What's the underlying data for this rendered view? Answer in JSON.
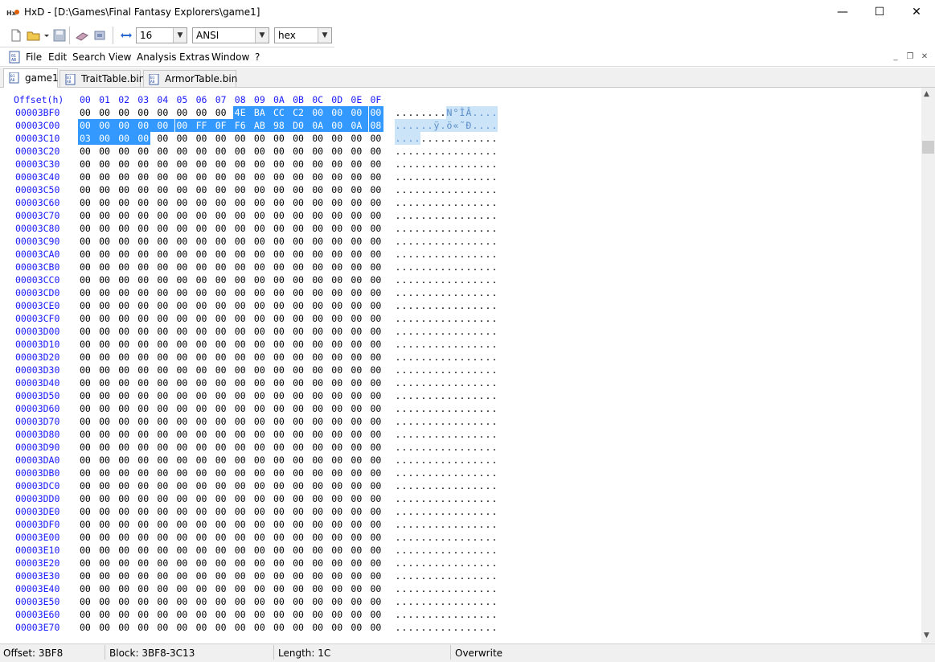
{
  "window": {
    "title": "HxD - [D:\\Games\\Final Fantasy Explorers\\game1]",
    "minimize_glyph": "—",
    "maximize_glyph": "☐",
    "close_glyph": "✕"
  },
  "toolbar": {
    "bytes_per_row": "16",
    "charset": "ANSI",
    "offset_base": "hex"
  },
  "menu": {
    "items": [
      "File",
      "Edit",
      "Search",
      "View",
      "Analysis",
      "Extras",
      "Window",
      "?"
    ]
  },
  "tabs": [
    {
      "label": "game1",
      "active": true
    },
    {
      "label": "TraitTable.bin",
      "active": false
    },
    {
      "label": "ArmorTable.bin",
      "active": false
    }
  ],
  "hex": {
    "header_label": "Offset(h)",
    "columns": [
      "00",
      "01",
      "02",
      "03",
      "04",
      "05",
      "06",
      "07",
      "08",
      "09",
      "0A",
      "0B",
      "0C",
      "0D",
      "0E",
      "0F"
    ],
    "rows": [
      {
        "offset": "00003BF0",
        "bytes": [
          "00",
          "00",
          "00",
          "00",
          "00",
          "00",
          "00",
          "00",
          "4E",
          "BA",
          "CC",
          "C2",
          "00",
          "00",
          "00",
          "00"
        ],
        "text": "........N°ÌÂ...."
      },
      {
        "offset": "00003C00",
        "bytes": [
          "00",
          "00",
          "00",
          "00",
          "00",
          "00",
          "FF",
          "0F",
          "F6",
          "AB",
          "98",
          "D0",
          "0A",
          "00",
          "0A",
          "08"
        ],
        "text": "......ÿ.ö«˜Ð...."
      },
      {
        "offset": "00003C10",
        "bytes": [
          "03",
          "00",
          "00",
          "00",
          "00",
          "00",
          "00",
          "00",
          "00",
          "00",
          "00",
          "00",
          "00",
          "00",
          "00",
          "00"
        ],
        "text": "................"
      },
      {
        "offset": "00003C20",
        "bytes": [
          "00",
          "00",
          "00",
          "00",
          "00",
          "00",
          "00",
          "00",
          "00",
          "00",
          "00",
          "00",
          "00",
          "00",
          "00",
          "00"
        ],
        "text": "................"
      },
      {
        "offset": "00003C30",
        "bytes": [
          "00",
          "00",
          "00",
          "00",
          "00",
          "00",
          "00",
          "00",
          "00",
          "00",
          "00",
          "00",
          "00",
          "00",
          "00",
          "00"
        ],
        "text": "................"
      },
      {
        "offset": "00003C40",
        "bytes": [
          "00",
          "00",
          "00",
          "00",
          "00",
          "00",
          "00",
          "00",
          "00",
          "00",
          "00",
          "00",
          "00",
          "00",
          "00",
          "00"
        ],
        "text": "................"
      },
      {
        "offset": "00003C50",
        "bytes": [
          "00",
          "00",
          "00",
          "00",
          "00",
          "00",
          "00",
          "00",
          "00",
          "00",
          "00",
          "00",
          "00",
          "00",
          "00",
          "00"
        ],
        "text": "................"
      },
      {
        "offset": "00003C60",
        "bytes": [
          "00",
          "00",
          "00",
          "00",
          "00",
          "00",
          "00",
          "00",
          "00",
          "00",
          "00",
          "00",
          "00",
          "00",
          "00",
          "00"
        ],
        "text": "................"
      },
      {
        "offset": "00003C70",
        "bytes": [
          "00",
          "00",
          "00",
          "00",
          "00",
          "00",
          "00",
          "00",
          "00",
          "00",
          "00",
          "00",
          "00",
          "00",
          "00",
          "00"
        ],
        "text": "................"
      },
      {
        "offset": "00003C80",
        "bytes": [
          "00",
          "00",
          "00",
          "00",
          "00",
          "00",
          "00",
          "00",
          "00",
          "00",
          "00",
          "00",
          "00",
          "00",
          "00",
          "00"
        ],
        "text": "................"
      },
      {
        "offset": "00003C90",
        "bytes": [
          "00",
          "00",
          "00",
          "00",
          "00",
          "00",
          "00",
          "00",
          "00",
          "00",
          "00",
          "00",
          "00",
          "00",
          "00",
          "00"
        ],
        "text": "................"
      },
      {
        "offset": "00003CA0",
        "bytes": [
          "00",
          "00",
          "00",
          "00",
          "00",
          "00",
          "00",
          "00",
          "00",
          "00",
          "00",
          "00",
          "00",
          "00",
          "00",
          "00"
        ],
        "text": "................"
      },
      {
        "offset": "00003CB0",
        "bytes": [
          "00",
          "00",
          "00",
          "00",
          "00",
          "00",
          "00",
          "00",
          "00",
          "00",
          "00",
          "00",
          "00",
          "00",
          "00",
          "00"
        ],
        "text": "................"
      },
      {
        "offset": "00003CC0",
        "bytes": [
          "00",
          "00",
          "00",
          "00",
          "00",
          "00",
          "00",
          "00",
          "00",
          "00",
          "00",
          "00",
          "00",
          "00",
          "00",
          "00"
        ],
        "text": "................"
      },
      {
        "offset": "00003CD0",
        "bytes": [
          "00",
          "00",
          "00",
          "00",
          "00",
          "00",
          "00",
          "00",
          "00",
          "00",
          "00",
          "00",
          "00",
          "00",
          "00",
          "00"
        ],
        "text": "................"
      },
      {
        "offset": "00003CE0",
        "bytes": [
          "00",
          "00",
          "00",
          "00",
          "00",
          "00",
          "00",
          "00",
          "00",
          "00",
          "00",
          "00",
          "00",
          "00",
          "00",
          "00"
        ],
        "text": "................"
      },
      {
        "offset": "00003CF0",
        "bytes": [
          "00",
          "00",
          "00",
          "00",
          "00",
          "00",
          "00",
          "00",
          "00",
          "00",
          "00",
          "00",
          "00",
          "00",
          "00",
          "00"
        ],
        "text": "................"
      },
      {
        "offset": "00003D00",
        "bytes": [
          "00",
          "00",
          "00",
          "00",
          "00",
          "00",
          "00",
          "00",
          "00",
          "00",
          "00",
          "00",
          "00",
          "00",
          "00",
          "00"
        ],
        "text": "................"
      },
      {
        "offset": "00003D10",
        "bytes": [
          "00",
          "00",
          "00",
          "00",
          "00",
          "00",
          "00",
          "00",
          "00",
          "00",
          "00",
          "00",
          "00",
          "00",
          "00",
          "00"
        ],
        "text": "................"
      },
      {
        "offset": "00003D20",
        "bytes": [
          "00",
          "00",
          "00",
          "00",
          "00",
          "00",
          "00",
          "00",
          "00",
          "00",
          "00",
          "00",
          "00",
          "00",
          "00",
          "00"
        ],
        "text": "................"
      },
      {
        "offset": "00003D30",
        "bytes": [
          "00",
          "00",
          "00",
          "00",
          "00",
          "00",
          "00",
          "00",
          "00",
          "00",
          "00",
          "00",
          "00",
          "00",
          "00",
          "00"
        ],
        "text": "................"
      },
      {
        "offset": "00003D40",
        "bytes": [
          "00",
          "00",
          "00",
          "00",
          "00",
          "00",
          "00",
          "00",
          "00",
          "00",
          "00",
          "00",
          "00",
          "00",
          "00",
          "00"
        ],
        "text": "................"
      },
      {
        "offset": "00003D50",
        "bytes": [
          "00",
          "00",
          "00",
          "00",
          "00",
          "00",
          "00",
          "00",
          "00",
          "00",
          "00",
          "00",
          "00",
          "00",
          "00",
          "00"
        ],
        "text": "................"
      },
      {
        "offset": "00003D60",
        "bytes": [
          "00",
          "00",
          "00",
          "00",
          "00",
          "00",
          "00",
          "00",
          "00",
          "00",
          "00",
          "00",
          "00",
          "00",
          "00",
          "00"
        ],
        "text": "................"
      },
      {
        "offset": "00003D70",
        "bytes": [
          "00",
          "00",
          "00",
          "00",
          "00",
          "00",
          "00",
          "00",
          "00",
          "00",
          "00",
          "00",
          "00",
          "00",
          "00",
          "00"
        ],
        "text": "................"
      },
      {
        "offset": "00003D80",
        "bytes": [
          "00",
          "00",
          "00",
          "00",
          "00",
          "00",
          "00",
          "00",
          "00",
          "00",
          "00",
          "00",
          "00",
          "00",
          "00",
          "00"
        ],
        "text": "................"
      },
      {
        "offset": "00003D90",
        "bytes": [
          "00",
          "00",
          "00",
          "00",
          "00",
          "00",
          "00",
          "00",
          "00",
          "00",
          "00",
          "00",
          "00",
          "00",
          "00",
          "00"
        ],
        "text": "................"
      },
      {
        "offset": "00003DA0",
        "bytes": [
          "00",
          "00",
          "00",
          "00",
          "00",
          "00",
          "00",
          "00",
          "00",
          "00",
          "00",
          "00",
          "00",
          "00",
          "00",
          "00"
        ],
        "text": "................"
      },
      {
        "offset": "00003DB0",
        "bytes": [
          "00",
          "00",
          "00",
          "00",
          "00",
          "00",
          "00",
          "00",
          "00",
          "00",
          "00",
          "00",
          "00",
          "00",
          "00",
          "00"
        ],
        "text": "................"
      },
      {
        "offset": "00003DC0",
        "bytes": [
          "00",
          "00",
          "00",
          "00",
          "00",
          "00",
          "00",
          "00",
          "00",
          "00",
          "00",
          "00",
          "00",
          "00",
          "00",
          "00"
        ],
        "text": "................"
      },
      {
        "offset": "00003DD0",
        "bytes": [
          "00",
          "00",
          "00",
          "00",
          "00",
          "00",
          "00",
          "00",
          "00",
          "00",
          "00",
          "00",
          "00",
          "00",
          "00",
          "00"
        ],
        "text": "................"
      },
      {
        "offset": "00003DE0",
        "bytes": [
          "00",
          "00",
          "00",
          "00",
          "00",
          "00",
          "00",
          "00",
          "00",
          "00",
          "00",
          "00",
          "00",
          "00",
          "00",
          "00"
        ],
        "text": "................"
      },
      {
        "offset": "00003DF0",
        "bytes": [
          "00",
          "00",
          "00",
          "00",
          "00",
          "00",
          "00",
          "00",
          "00",
          "00",
          "00",
          "00",
          "00",
          "00",
          "00",
          "00"
        ],
        "text": "................"
      },
      {
        "offset": "00003E00",
        "bytes": [
          "00",
          "00",
          "00",
          "00",
          "00",
          "00",
          "00",
          "00",
          "00",
          "00",
          "00",
          "00",
          "00",
          "00",
          "00",
          "00"
        ],
        "text": "................"
      },
      {
        "offset": "00003E10",
        "bytes": [
          "00",
          "00",
          "00",
          "00",
          "00",
          "00",
          "00",
          "00",
          "00",
          "00",
          "00",
          "00",
          "00",
          "00",
          "00",
          "00"
        ],
        "text": "................"
      },
      {
        "offset": "00003E20",
        "bytes": [
          "00",
          "00",
          "00",
          "00",
          "00",
          "00",
          "00",
          "00",
          "00",
          "00",
          "00",
          "00",
          "00",
          "00",
          "00",
          "00"
        ],
        "text": "................"
      },
      {
        "offset": "00003E30",
        "bytes": [
          "00",
          "00",
          "00",
          "00",
          "00",
          "00",
          "00",
          "00",
          "00",
          "00",
          "00",
          "00",
          "00",
          "00",
          "00",
          "00"
        ],
        "text": "................"
      },
      {
        "offset": "00003E40",
        "bytes": [
          "00",
          "00",
          "00",
          "00",
          "00",
          "00",
          "00",
          "00",
          "00",
          "00",
          "00",
          "00",
          "00",
          "00",
          "00",
          "00"
        ],
        "text": "................"
      },
      {
        "offset": "00003E50",
        "bytes": [
          "00",
          "00",
          "00",
          "00",
          "00",
          "00",
          "00",
          "00",
          "00",
          "00",
          "00",
          "00",
          "00",
          "00",
          "00",
          "00"
        ],
        "text": "................"
      },
      {
        "offset": "00003E60",
        "bytes": [
          "00",
          "00",
          "00",
          "00",
          "00",
          "00",
          "00",
          "00",
          "00",
          "00",
          "00",
          "00",
          "00",
          "00",
          "00",
          "00"
        ],
        "text": "................"
      },
      {
        "offset": "00003E70",
        "bytes": [
          "00",
          "00",
          "00",
          "00",
          "00",
          "00",
          "00",
          "00",
          "00",
          "00",
          "00",
          "00",
          "00",
          "00",
          "00",
          "00"
        ],
        "text": "................"
      }
    ],
    "selection": {
      "start_offset": "3BF8",
      "end_offset": "3C13",
      "length": 28
    },
    "colors": {
      "offset_text": "#1a1aff",
      "selection_bg": "#3399ff",
      "selection_text": "#ffffff",
      "text_selection_bg": "#cce4f7",
      "text_selection_fg": "#5a8cc8"
    }
  },
  "status": {
    "offset": "Offset: 3BF8",
    "block": "Block: 3BF8-3C13",
    "length": "Length: 1C",
    "mode": "Overwrite"
  }
}
